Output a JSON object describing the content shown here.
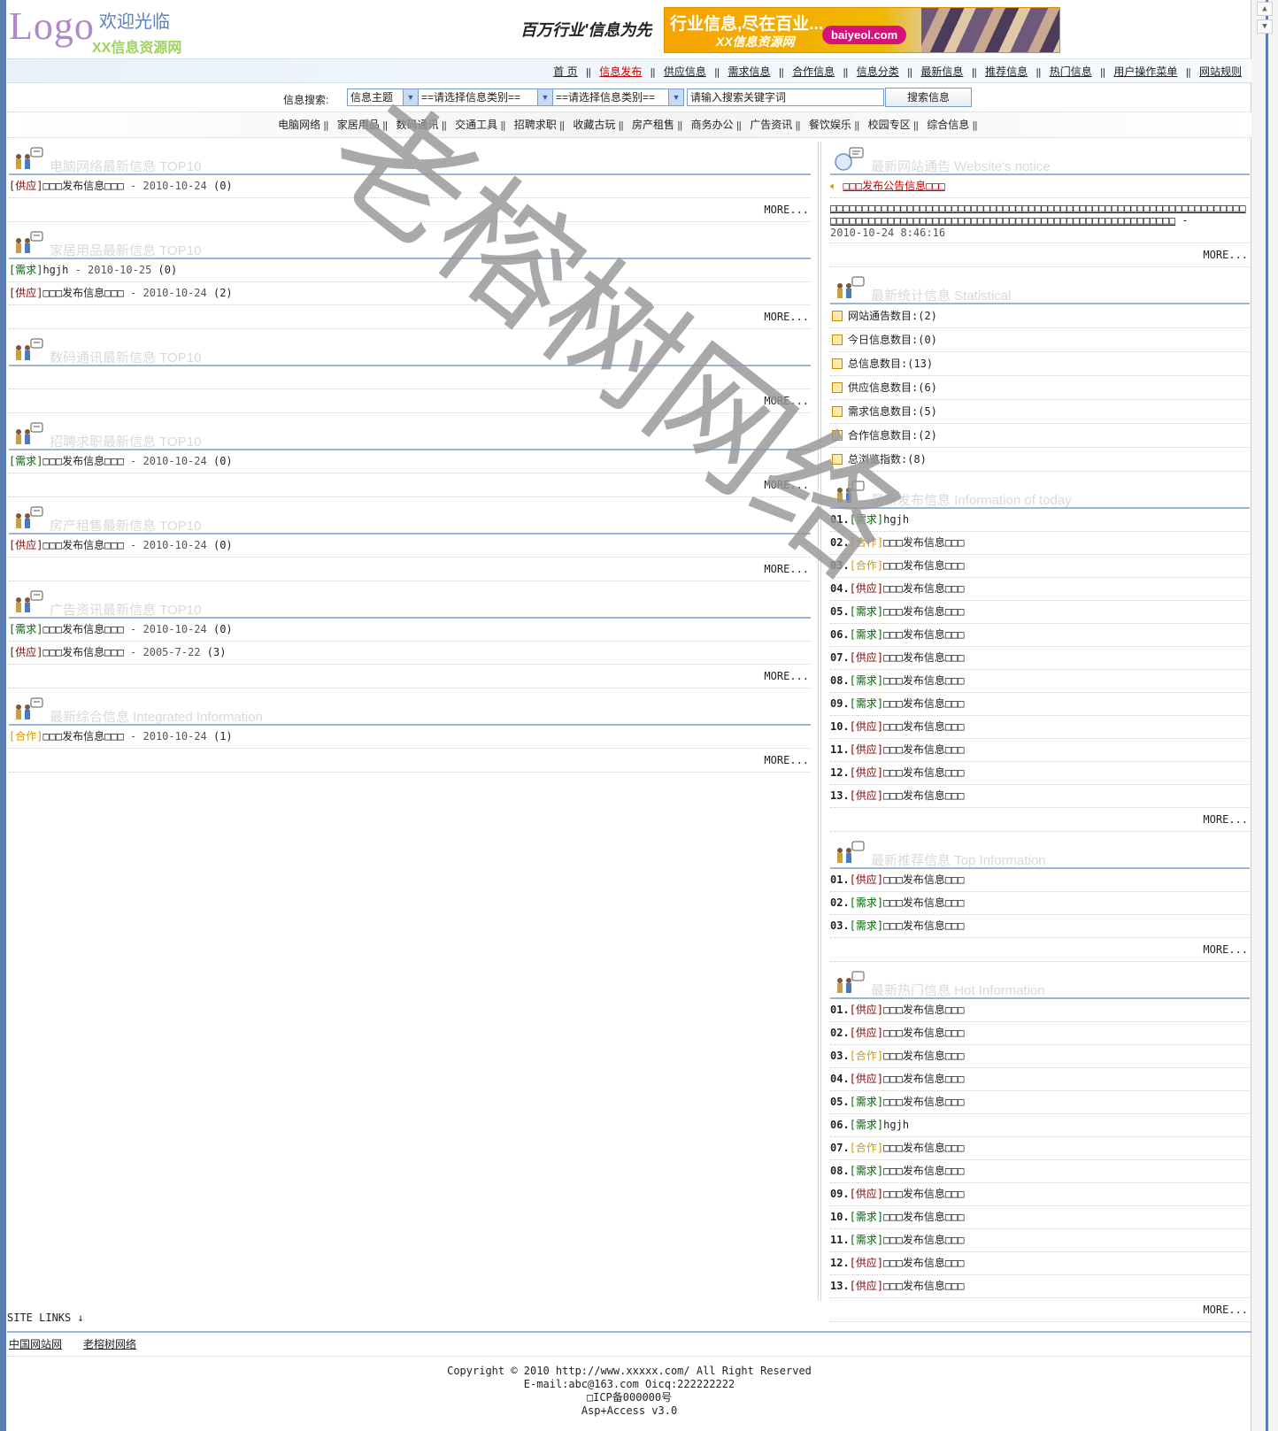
{
  "header": {
    "logo": "Logo",
    "welcome": "欢迎光临",
    "site_name": "XX信息资源网",
    "slogan": "百万行业'信息为先",
    "banner": {
      "line1": "行业信息,尽在百业...",
      "line2": "XX信息资源网",
      "url": "baiyeol.com"
    }
  },
  "topnav": [
    "首 页",
    "信息发布",
    "供应信息",
    "需求信息",
    "合作信息",
    "信息分类",
    "最新信息",
    "推荐信息",
    "热门信息",
    "用户操作菜单",
    "网站规则"
  ],
  "search": {
    "label": "信息搜索:",
    "field": "信息主题",
    "type_select": "==请选择信息类别==",
    "class_select": "==请选择信息类别==",
    "keyword_placeholder": "请输入搜索关键字词",
    "button": "搜索信息"
  },
  "categories": [
    "电脑网络",
    "家居用品",
    "数码通讯",
    "交通工具",
    "招聘求职",
    "收藏古玩",
    "房产租售",
    "商务办公",
    "广告资讯",
    "餐饮娱乐",
    "校园专区",
    "综合信息"
  ],
  "more": "MORE...",
  "left_sections": [
    {
      "title": "电脑网络最新信息 TOP10",
      "items": [
        {
          "tag": "[供应]",
          "kind": "supply",
          "title": "□□□发布信息□□□",
          "date": "2010-10-24",
          "count": "(0)"
        }
      ]
    },
    {
      "title": "家居用品最新信息 TOP10",
      "items": [
        {
          "tag": "[需求]",
          "kind": "demand",
          "title": "hgjh",
          "date": "2010-10-25",
          "count": "(0)"
        },
        {
          "tag": "[供应]",
          "kind": "supply",
          "title": "□□□发布信息□□□",
          "date": "2010-10-24",
          "count": "(2)"
        }
      ]
    },
    {
      "title": "数码通讯最新信息 TOP10",
      "items": []
    },
    {
      "title": "招聘求职最新信息 TOP10",
      "items": [
        {
          "tag": "[需求]",
          "kind": "demand",
          "title": "□□□发布信息□□□",
          "date": "2010-10-24",
          "count": "(0)"
        }
      ]
    },
    {
      "title": "房产租售最新信息 TOP10",
      "items": [
        {
          "tag": "[供应]",
          "kind": "supply",
          "title": "□□□发布信息□□□",
          "date": "2010-10-24",
          "count": "(0)"
        }
      ]
    },
    {
      "title": "广告资讯最新信息 TOP10",
      "items": [
        {
          "tag": "[需求]",
          "kind": "demand",
          "title": "□□□发布信息□□□",
          "date": "2010-10-24",
          "count": "(0)"
        },
        {
          "tag": "[供应]",
          "kind": "supply",
          "title": "□□□发布信息□□□",
          "date": "2005-7-22",
          "count": "(3)"
        }
      ]
    },
    {
      "title": "最新综合信息 Integrated Information",
      "items": [
        {
          "tag": "[合作]",
          "kind": "coop",
          "title": "□□□发布信息□□□",
          "date": "2010-10-24",
          "count": "(1)"
        }
      ]
    }
  ],
  "notice": {
    "title": "最新网站通告 Website's notice",
    "link": "□□□发布公告信息□□□",
    "body": "□□□□□□□□□□□□□□□□□□□□□□□□□□□□□□□□□□□□□□□□□□□□□□□□□□□□□□□□□□□□□□□□□□□□□□□□□□□□□□□□□□□□□□□□□□□□□□□□□□□□□□□□□□□□□□□□□□□□□□□",
    "date": "2010-10-24 8:46:16"
  },
  "stats": {
    "title": "最新统计信息 Statistical",
    "items": [
      {
        "label": "网站通告数目:",
        "value": "(2)"
      },
      {
        "label": "今日信息数目:",
        "value": "(0)"
      },
      {
        "label": "总信息数目:",
        "value": "(13)"
      },
      {
        "label": "供应信息数目:",
        "value": "(6)"
      },
      {
        "label": "需求信息数目:",
        "value": "(5)"
      },
      {
        "label": "合作信息数目:",
        "value": "(2)"
      },
      {
        "label": "总浏览指数:",
        "value": "(8)"
      }
    ]
  },
  "today": {
    "title": "最新发布信息 Information of today",
    "items": [
      {
        "no": "01.",
        "tag": "[需求]",
        "kind": "demand",
        "title": "hgjh"
      },
      {
        "no": "02.",
        "tag": "[合作]",
        "kind": "coop",
        "title": "□□□发布信息□□□"
      },
      {
        "no": "03.",
        "tag": "[合作]",
        "kind": "coop",
        "title": "□□□发布信息□□□"
      },
      {
        "no": "04.",
        "tag": "[供应]",
        "kind": "supply",
        "title": "□□□发布信息□□□"
      },
      {
        "no": "05.",
        "tag": "[需求]",
        "kind": "demand",
        "title": "□□□发布信息□□□"
      },
      {
        "no": "06.",
        "tag": "[需求]",
        "kind": "demand",
        "title": "□□□发布信息□□□"
      },
      {
        "no": "07.",
        "tag": "[供应]",
        "kind": "supply",
        "title": "□□□发布信息□□□"
      },
      {
        "no": "08.",
        "tag": "[需求]",
        "kind": "demand",
        "title": "□□□发布信息□□□"
      },
      {
        "no": "09.",
        "tag": "[需求]",
        "kind": "demand",
        "title": "□□□发布信息□□□"
      },
      {
        "no": "10.",
        "tag": "[供应]",
        "kind": "supply",
        "title": "□□□发布信息□□□"
      },
      {
        "no": "11.",
        "tag": "[供应]",
        "kind": "supply",
        "title": "□□□发布信息□□□"
      },
      {
        "no": "12.",
        "tag": "[供应]",
        "kind": "supply",
        "title": "□□□发布信息□□□"
      },
      {
        "no": "13.",
        "tag": "[供应]",
        "kind": "supply",
        "title": "□□□发布信息□□□"
      }
    ]
  },
  "top": {
    "title": "最新推荐信息 Top Information",
    "items": [
      {
        "no": "01.",
        "tag": "[供应]",
        "kind": "supply",
        "title": "□□□发布信息□□□"
      },
      {
        "no": "02.",
        "tag": "[需求]",
        "kind": "demand",
        "title": "□□□发布信息□□□"
      },
      {
        "no": "03.",
        "tag": "[需求]",
        "kind": "demand",
        "title": "□□□发布信息□□□"
      }
    ]
  },
  "hot": {
    "title": "最新热门信息 Hot Information",
    "items": [
      {
        "no": "01.",
        "tag": "[供应]",
        "kind": "supply",
        "title": "□□□发布信息□□□"
      },
      {
        "no": "02.",
        "tag": "[供应]",
        "kind": "supply",
        "title": "□□□发布信息□□□"
      },
      {
        "no": "03.",
        "tag": "[合作]",
        "kind": "coop",
        "title": "□□□发布信息□□□"
      },
      {
        "no": "04.",
        "tag": "[供应]",
        "kind": "supply",
        "title": "□□□发布信息□□□"
      },
      {
        "no": "05.",
        "tag": "[需求]",
        "kind": "demand",
        "title": "□□□发布信息□□□"
      },
      {
        "no": "06.",
        "tag": "[需求]",
        "kind": "demand",
        "title": "hgjh"
      },
      {
        "no": "07.",
        "tag": "[合作]",
        "kind": "coop",
        "title": "□□□发布信息□□□"
      },
      {
        "no": "08.",
        "tag": "[需求]",
        "kind": "demand",
        "title": "□□□发布信息□□□"
      },
      {
        "no": "09.",
        "tag": "[供应]",
        "kind": "supply",
        "title": "□□□发布信息□□□"
      },
      {
        "no": "10.",
        "tag": "[需求]",
        "kind": "demand",
        "title": "□□□发布信息□□□"
      },
      {
        "no": "11.",
        "tag": "[需求]",
        "kind": "demand",
        "title": "□□□发布信息□□□"
      },
      {
        "no": "12.",
        "tag": "[供应]",
        "kind": "supply",
        "title": "□□□发布信息□□□"
      },
      {
        "no": "13.",
        "tag": "[供应]",
        "kind": "supply",
        "title": "□□□发布信息□□□"
      }
    ]
  },
  "footer": {
    "site_links_label": "SITE LINKS ↓",
    "links": [
      "中国网站网",
      "老榕树网络"
    ],
    "copyright": "Copyright © 2010 http://www.xxxxx.com/ All Right Reserved",
    "contact": "E-mail:abc@163.com Oicq:222222222",
    "icp": "□ICP备000000号",
    "powered": "Asp+Access v3.0"
  },
  "watermark": "老榕树网络",
  "colors": {
    "supply": "#8b0000",
    "demand": "#006400",
    "coop": "#d29a00",
    "accent": "#9db4d9"
  }
}
